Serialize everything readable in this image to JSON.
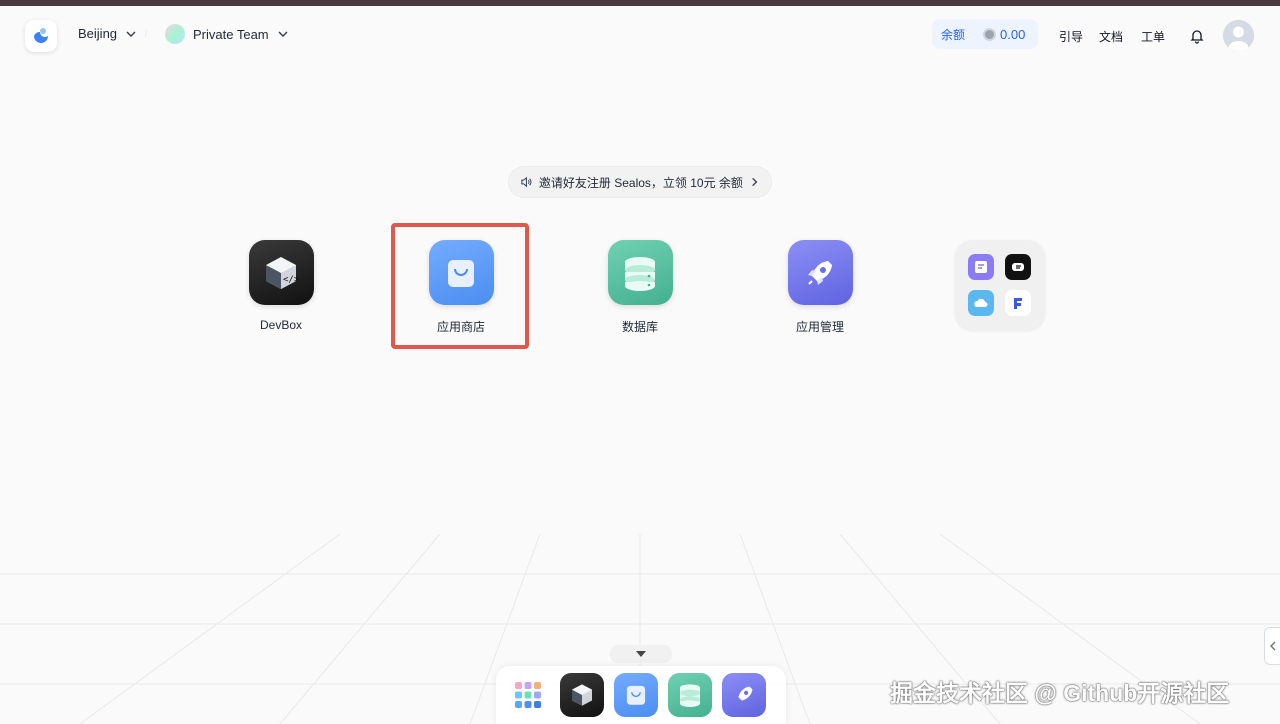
{
  "header": {
    "region": "Beijing",
    "team": "Private Team",
    "balance_label": "余额",
    "balance_amount": "0.00",
    "nav": [
      "引导",
      "文档",
      "工单"
    ]
  },
  "notice": {
    "text": "邀请好友注册 Sealos，立领 10元 余额"
  },
  "apps": [
    {
      "label": "DevBox",
      "icon": "devbox-icon"
    },
    {
      "label": "应用商店",
      "icon": "app-store-icon"
    },
    {
      "label": "数据库",
      "icon": "database-icon"
    },
    {
      "label": "应用管理",
      "icon": "rocket-icon"
    }
  ],
  "colors": {
    "highlight": "#e2574c",
    "accent": "#2563eb",
    "appstore": "#5b9cf5",
    "database": "#5cc3a3",
    "rocket": "#7b80f0"
  },
  "watermark": "掘金技术社区 @ Github开源社区"
}
